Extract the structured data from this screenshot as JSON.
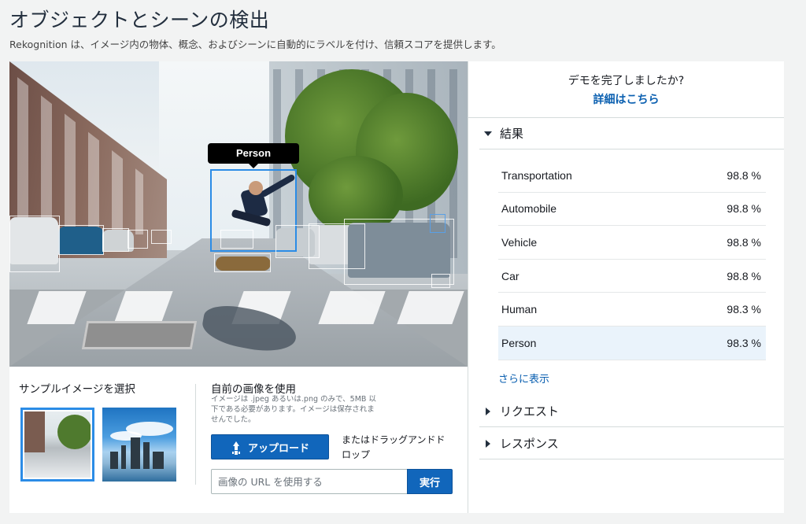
{
  "header": {
    "title": "オブジェクトとシーンの検出",
    "description": "Rekognition は、イメージ内の物体、概念、およびシーンに自動的にラベルを付け、信頼スコアを提供します。"
  },
  "image_panel": {
    "selected_label": "Person"
  },
  "sample": {
    "title": "サンプルイメージを選択",
    "thumbnails": [
      "street-skateboard",
      "city-skyline"
    ]
  },
  "own_image": {
    "title": "自前の画像を使用",
    "note": "イメージは .jpeg あるいは.png のみで、5MB 以下である必要があります。イメージは保存されませんでした。",
    "upload_label": "アップロード",
    "drag_text": "またはドラッグアンドドロップ",
    "url_placeholder": "画像の URL を使用する",
    "run_label": "実行"
  },
  "demo": {
    "question": "デモを完了しましたか?",
    "link": "詳細はこちら"
  },
  "results": {
    "section_label": "結果",
    "rows": [
      {
        "label": "Transportation",
        "score": "98.8 %"
      },
      {
        "label": "Automobile",
        "score": "98.8 %"
      },
      {
        "label": "Vehicle",
        "score": "98.8 %"
      },
      {
        "label": "Car",
        "score": "98.8 %"
      },
      {
        "label": "Human",
        "score": "98.3 %"
      },
      {
        "label": "Person",
        "score": "98.3 %"
      }
    ],
    "more_label": "さらに表示"
  },
  "request": {
    "label": "リクエスト"
  },
  "response": {
    "label": "レスポンス"
  },
  "colors": {
    "accent": "#1166bb",
    "link": "#0a5fb0",
    "selected_row": "#eaf3fb",
    "bbox_selected": "#2b8ce6"
  }
}
